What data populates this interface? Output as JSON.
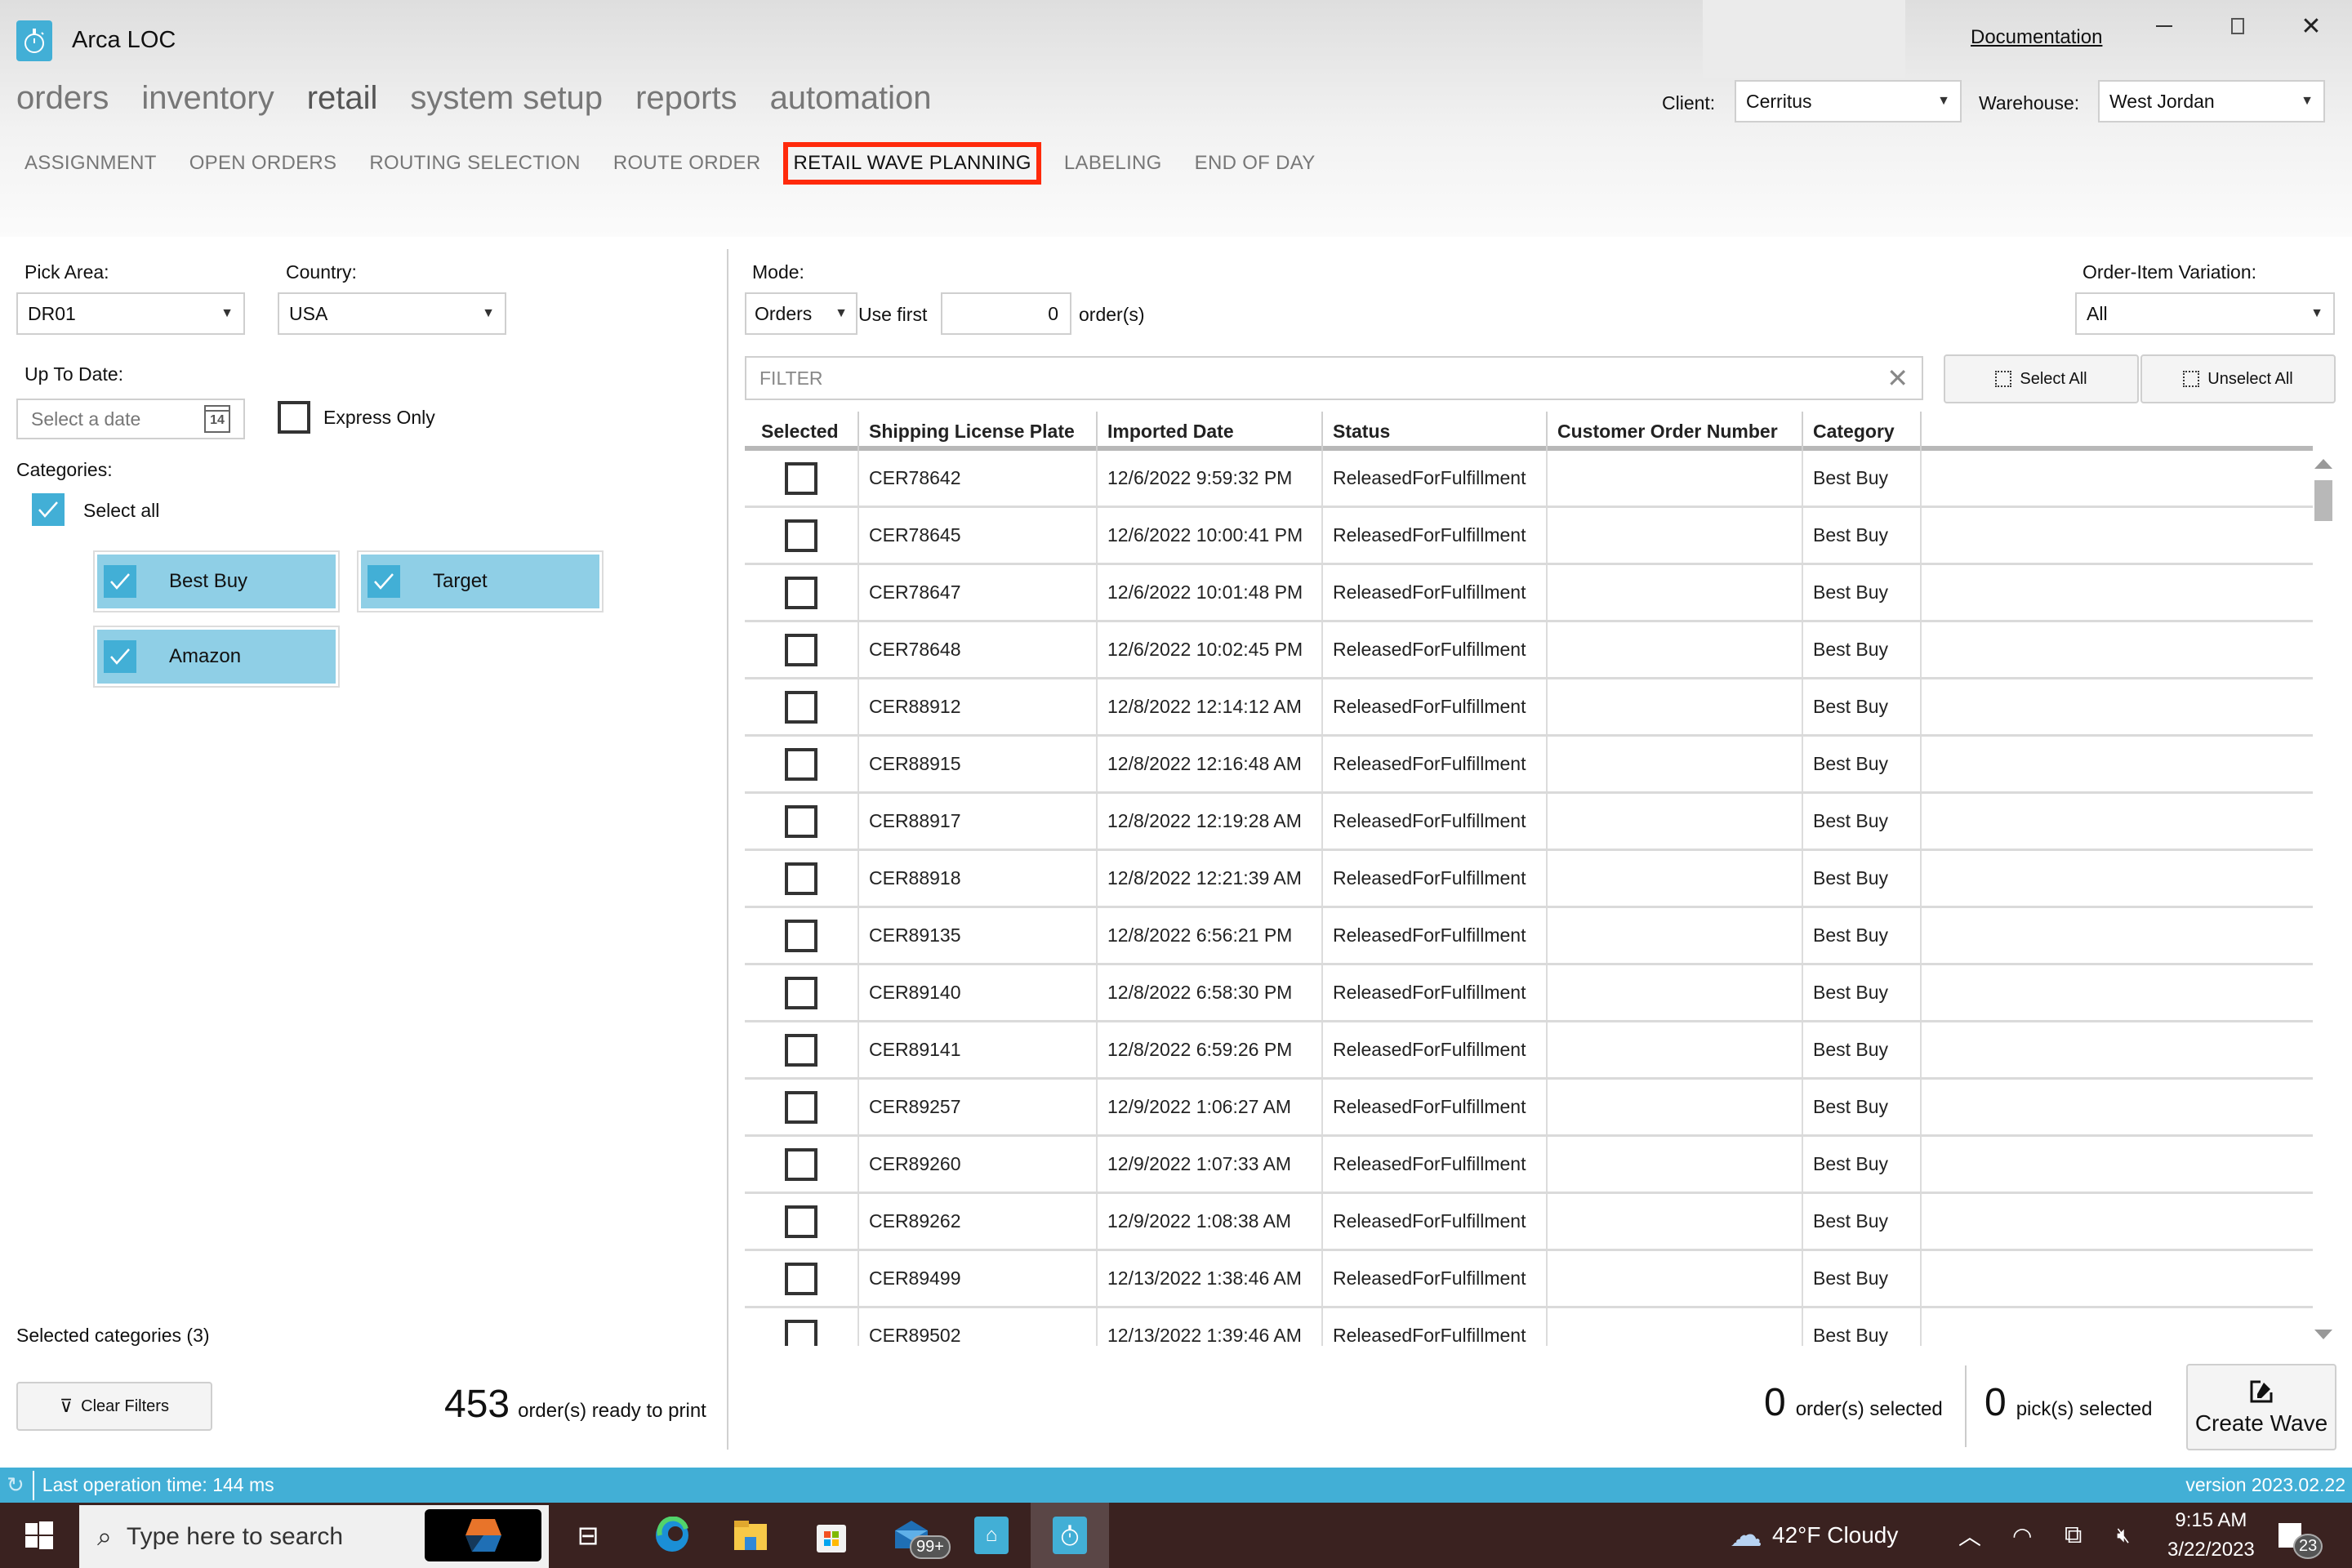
{
  "window": {
    "app_title": "Arca LOC",
    "documentation_link": "Documentation",
    "controls": [
      "minimize",
      "restore",
      "close"
    ]
  },
  "main_nav": [
    {
      "label": "orders",
      "active": false
    },
    {
      "label": "inventory",
      "active": false
    },
    {
      "label": "retail",
      "active": true
    },
    {
      "label": "system setup",
      "active": false
    },
    {
      "label": "reports",
      "active": false
    },
    {
      "label": "automation",
      "active": false
    }
  ],
  "sub_nav": [
    {
      "label": "ASSIGNMENT",
      "active": false
    },
    {
      "label": "OPEN ORDERS",
      "active": false
    },
    {
      "label": "ROUTING SELECTION",
      "active": false
    },
    {
      "label": "ROUTE ORDER",
      "active": false
    },
    {
      "label": "RETAIL WAVE PLANNING",
      "active": true
    },
    {
      "label": "LABELING",
      "active": false
    },
    {
      "label": "END OF DAY",
      "active": false
    }
  ],
  "context": {
    "client_label": "Client:",
    "client_value": "Cerritus",
    "warehouse_label": "Warehouse:",
    "warehouse_value": "West Jordan"
  },
  "filters": {
    "pick_area_label": "Pick Area:",
    "pick_area_value": "DR01",
    "country_label": "Country:",
    "country_value": "USA",
    "up_to_date_label": "Up To Date:",
    "date_placeholder": "Select a date",
    "calendar_day": "14",
    "express_only_label": "Express Only",
    "express_only_checked": false,
    "categories_label": "Categories:",
    "select_all_label": "Select all",
    "select_all_checked": true,
    "categories": [
      {
        "label": "Best Buy",
        "checked": true
      },
      {
        "label": "Target",
        "checked": true
      },
      {
        "label": "Amazon",
        "checked": true
      }
    ],
    "selected_categories_text": "Selected categories (3)",
    "clear_filters_label": "Clear Filters",
    "ready_count": "453",
    "ready_text": "order(s) ready to print"
  },
  "mode": {
    "mode_label": "Mode:",
    "mode_value": "Orders",
    "use_first_label": "Use first",
    "use_first_value": "0",
    "orders_suffix": "order(s)",
    "variation_label": "Order-Item Variation:",
    "variation_value": "All",
    "filter_placeholder": "FILTER",
    "select_all_btn": "Select All",
    "unselect_all_btn": "Unselect All"
  },
  "table": {
    "columns": [
      "Selected",
      "Shipping License Plate",
      "Imported Date",
      "Status",
      "Customer Order Number",
      "Category"
    ],
    "rows": [
      {
        "plate": "CER78642",
        "date": "12/6/2022 9:59:32 PM",
        "status": "ReleasedForFulfillment",
        "order_no": "",
        "category": "Best Buy",
        "selected": false
      },
      {
        "plate": "CER78645",
        "date": "12/6/2022 10:00:41 PM",
        "status": "ReleasedForFulfillment",
        "order_no": "",
        "category": "Best Buy",
        "selected": false
      },
      {
        "plate": "CER78647",
        "date": "12/6/2022 10:01:48 PM",
        "status": "ReleasedForFulfillment",
        "order_no": "",
        "category": "Best Buy",
        "selected": false
      },
      {
        "plate": "CER78648",
        "date": "12/6/2022 10:02:45 PM",
        "status": "ReleasedForFulfillment",
        "order_no": "",
        "category": "Best Buy",
        "selected": false
      },
      {
        "plate": "CER88912",
        "date": "12/8/2022 12:14:12 AM",
        "status": "ReleasedForFulfillment",
        "order_no": "",
        "category": "Best Buy",
        "selected": false
      },
      {
        "plate": "CER88915",
        "date": "12/8/2022 12:16:48 AM",
        "status": "ReleasedForFulfillment",
        "order_no": "",
        "category": "Best Buy",
        "selected": false
      },
      {
        "plate": "CER88917",
        "date": "12/8/2022 12:19:28 AM",
        "status": "ReleasedForFulfillment",
        "order_no": "",
        "category": "Best Buy",
        "selected": false
      },
      {
        "plate": "CER88918",
        "date": "12/8/2022 12:21:39 AM",
        "status": "ReleasedForFulfillment",
        "order_no": "",
        "category": "Best Buy",
        "selected": false
      },
      {
        "plate": "CER89135",
        "date": "12/8/2022 6:56:21 PM",
        "status": "ReleasedForFulfillment",
        "order_no": "",
        "category": "Best Buy",
        "selected": false
      },
      {
        "plate": "CER89140",
        "date": "12/8/2022 6:58:30 PM",
        "status": "ReleasedForFulfillment",
        "order_no": "",
        "category": "Best Buy",
        "selected": false
      },
      {
        "plate": "CER89141",
        "date": "12/8/2022 6:59:26 PM",
        "status": "ReleasedForFulfillment",
        "order_no": "",
        "category": "Best Buy",
        "selected": false
      },
      {
        "plate": "CER89257",
        "date": "12/9/2022 1:06:27 AM",
        "status": "ReleasedForFulfillment",
        "order_no": "",
        "category": "Best Buy",
        "selected": false
      },
      {
        "plate": "CER89260",
        "date": "12/9/2022 1:07:33 AM",
        "status": "ReleasedForFulfillment",
        "order_no": "",
        "category": "Best Buy",
        "selected": false
      },
      {
        "plate": "CER89262",
        "date": "12/9/2022 1:08:38 AM",
        "status": "ReleasedForFulfillment",
        "order_no": "",
        "category": "Best Buy",
        "selected": false
      },
      {
        "plate": "CER89499",
        "date": "12/13/2022 1:38:46 AM",
        "status": "ReleasedForFulfillment",
        "order_no": "",
        "category": "Best Buy",
        "selected": false
      },
      {
        "plate": "CER89502",
        "date": "12/13/2022 1:39:46 AM",
        "status": "ReleasedForFulfillment",
        "order_no": "",
        "category": "Best Buy",
        "selected": false
      }
    ]
  },
  "summary": {
    "orders_selected_count": "0",
    "orders_selected_text": "order(s) selected",
    "picks_selected_count": "0",
    "picks_selected_text": "pick(s) selected",
    "create_wave_label": "Create Wave"
  },
  "status_bar": {
    "last_operation": "Last operation time:  144 ms",
    "version": "version 2023.02.22"
  },
  "taskbar": {
    "search_placeholder": "Type here to search",
    "mail_badge": "99+",
    "weather": "42°F  Cloudy",
    "time": "9:15 AM",
    "date": "3/22/2023",
    "notifications_count": "23"
  },
  "colors": {
    "accent": "#42afd6",
    "category_tile": "#8fcfe6",
    "highlight_box": "#ff2a0b",
    "taskbar": "#3a2220"
  }
}
